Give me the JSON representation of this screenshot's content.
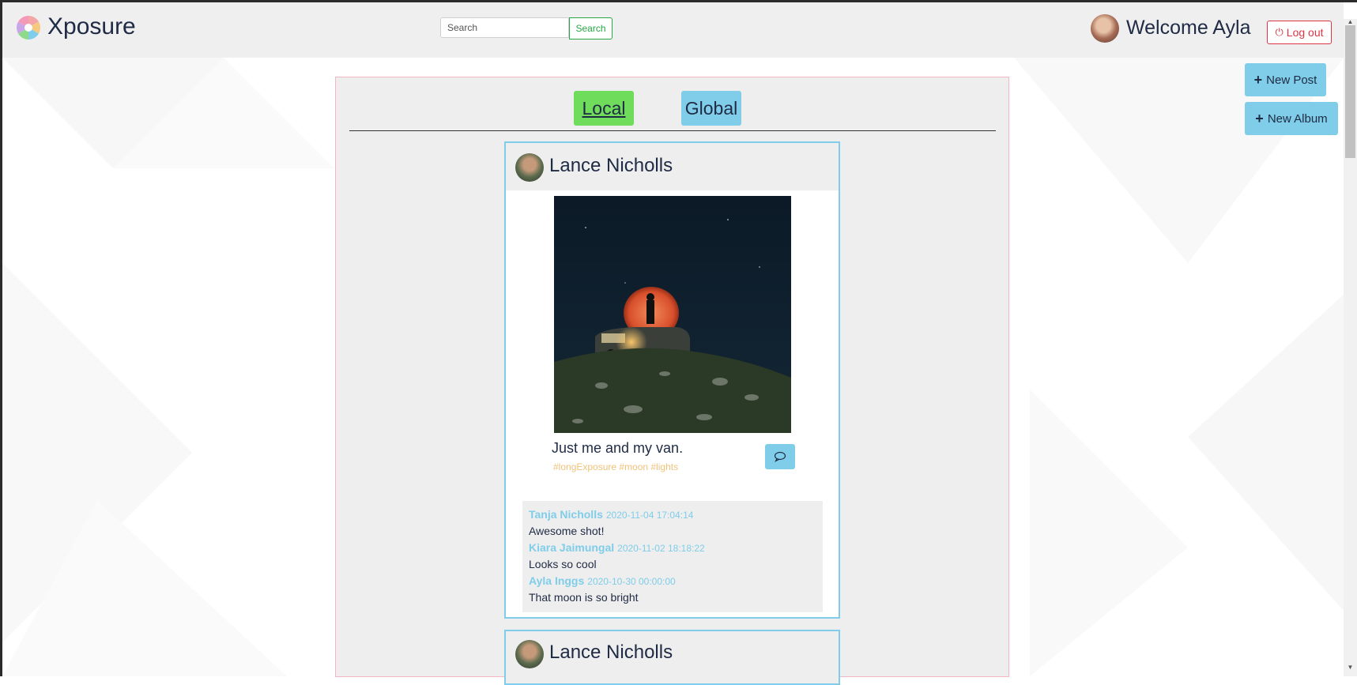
{
  "navbar": {
    "brand": "Xposure",
    "search_placeholder": "Search",
    "search_button": "Search",
    "welcome": "Welcome Ayla",
    "logout_label": "Log out"
  },
  "actions": {
    "new_post": "New Post",
    "new_album": "New Album"
  },
  "tabs": [
    {
      "label": "Local",
      "active": true,
      "color": "#6fdc5c"
    },
    {
      "label": "Global",
      "active": false,
      "color": "#7fcde8"
    }
  ],
  "posts": [
    {
      "author": "Lance Nicholls",
      "caption": "Just me and my van.",
      "tags": "#longExposure #moon #lights",
      "comments": [
        {
          "author": "Tanja Nicholls",
          "date": "2020-11-04 17:04:14",
          "text": "Awesome shot!"
        },
        {
          "author": "Kiara Jaimungal",
          "date": "2020-11-02 18:18:22",
          "text": "Looks so cool"
        },
        {
          "author": "Ayla Inggs",
          "date": "2020-10-30 00:00:00",
          "text": "That moon is so bright"
        }
      ]
    },
    {
      "author": "Lance Nicholls"
    }
  ],
  "colors": {
    "accent": "#7fcde8",
    "local_tab": "#6fdc5c",
    "logout": "#dc3545",
    "search": "#28a745",
    "tags": "#f0c27a"
  }
}
